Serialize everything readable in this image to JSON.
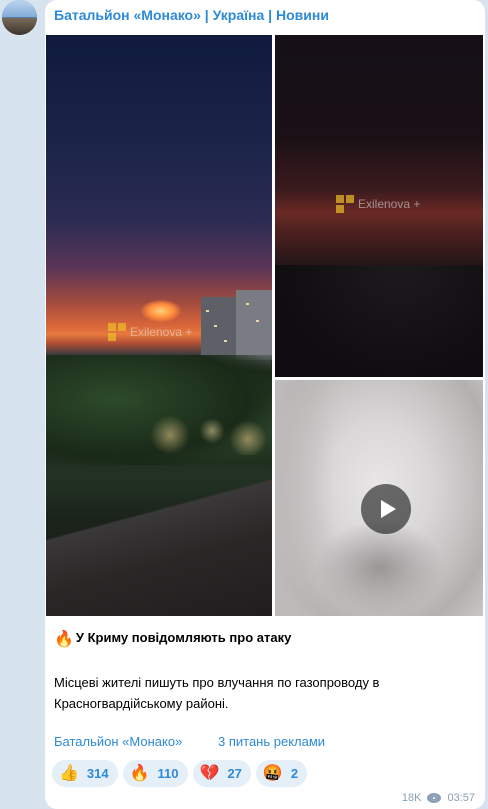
{
  "channel": {
    "title": "Батальйон «Монако» | Україна | Новини"
  },
  "media": {
    "watermark_text": "Exilenova +",
    "video_play_icon": "play-icon"
  },
  "post": {
    "headline_emoji": "🔥",
    "headline": "У Криму повідомляють про атаку",
    "body": "Місцеві жителі пишуть про влучання по газопроводу в Красногвардійському районі.",
    "links": [
      {
        "label": "Батальйон «Монако»"
      },
      {
        "label": "3 питань реклами"
      }
    ]
  },
  "reactions": [
    {
      "emoji": "👍",
      "icon": "thumbs-up-icon",
      "count": "314"
    },
    {
      "emoji": "🔥",
      "icon": "fire-icon",
      "count": "110"
    },
    {
      "emoji": "💔",
      "icon": "heart-break-icon",
      "count": "27"
    },
    {
      "emoji": "🤬",
      "icon": "angry-face-icon",
      "count": "2"
    }
  ],
  "meta": {
    "views": "18K",
    "time": "03:57"
  },
  "colors": {
    "accent": "#2e8ad6",
    "background": "#d7e3ee",
    "reaction_bg": "#e5eff8"
  }
}
